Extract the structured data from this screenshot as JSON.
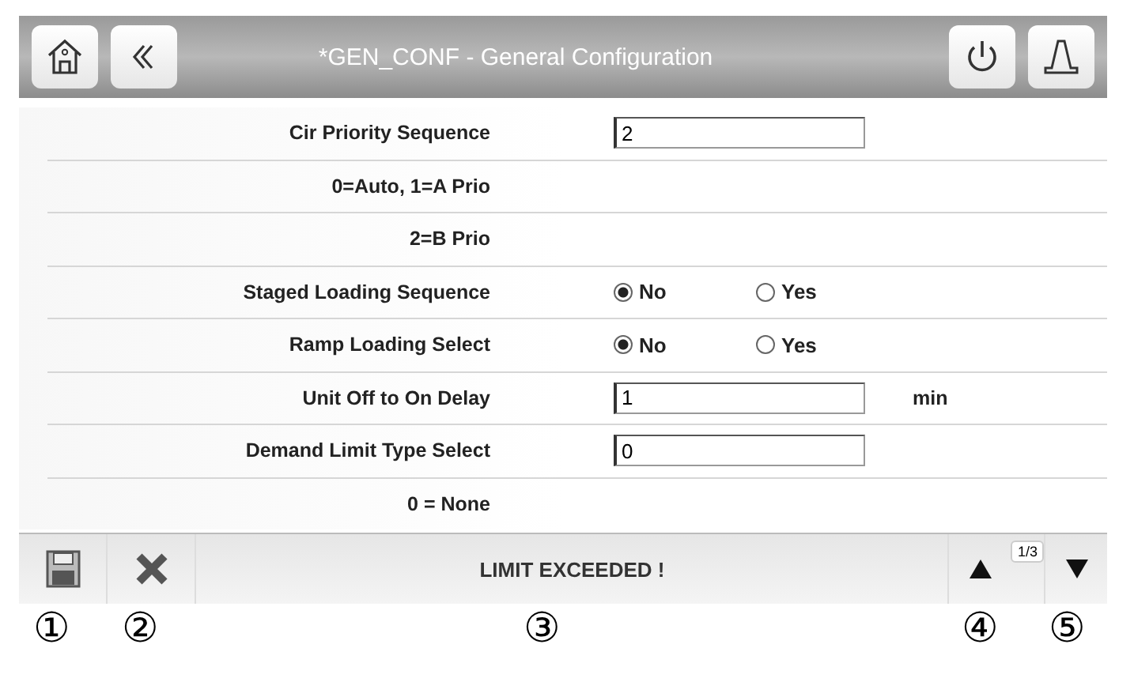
{
  "header": {
    "title": "*GEN_CONF - General Configuration"
  },
  "rows": [
    {
      "kind": "field",
      "label": "Cir Priority Sequence",
      "value": "2"
    },
    {
      "kind": "note",
      "label": "0=Auto,  1=A Prio"
    },
    {
      "kind": "note",
      "label": "2=B Prio"
    },
    {
      "kind": "radio",
      "label": "Staged Loading Sequence",
      "options": [
        {
          "label": "No",
          "selected": true
        },
        {
          "label": "Yes",
          "selected": false
        }
      ]
    },
    {
      "kind": "radio",
      "label": "Ramp Loading Select",
      "options": [
        {
          "label": "No",
          "selected": true
        },
        {
          "label": "Yes",
          "selected": false
        }
      ]
    },
    {
      "kind": "field",
      "label": "Unit Off to On Delay",
      "value": "1",
      "unit": "min"
    },
    {
      "kind": "field",
      "label": "Demand Limit Type Select",
      "value": "0"
    },
    {
      "kind": "note",
      "label": "0 = None"
    }
  ],
  "footer": {
    "message": "LIMIT EXCEEDED !",
    "page": "1/3"
  },
  "callouts": [
    "①",
    "②",
    "③",
    "④",
    "⑤"
  ]
}
